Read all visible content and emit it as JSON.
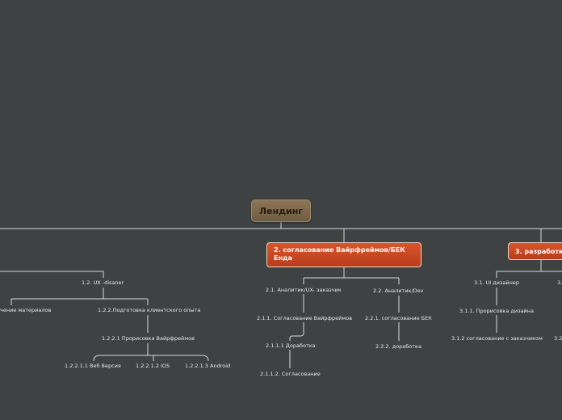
{
  "root": {
    "label": "Лендинг"
  },
  "branches": [
    {
      "label": "2. согласование Вайрфреймов/БЕК\nЕнда"
    },
    {
      "label": "3. разработк"
    }
  ],
  "nodes": {
    "ux_designer": "1.2. UX -disaner",
    "materials": "чение материалов",
    "client_exp": "1.2.2.Подготовка клиентского опыта",
    "wireframes": "1.2.2.1 Прорисовка Вайрфреймов",
    "web": "1.2.2.1.1 Веб Версия",
    "ios": "1.2.2.1.2 IOS",
    "android": "1.2.2.1.3 Android",
    "analyst_ux": "2.1. Аналитик/UX- заказчик",
    "agree_wire": "2.1.1. Согласование Вайрфреймов",
    "rework": "2.1.1.1 Доработка",
    "agreement": "2.1.1.2. Согласование",
    "analyst_dev": "2.2. Аналитик/Dev",
    "agree_back": "2.2.1. согласование БЕК",
    "rework2": "2.2.2. доработка",
    "ui_designer": "3.1. UI дизайнер",
    "design": "3.1.1. Прорисовка дизайна",
    "agree_client": "3.1.2 согласование с заказчиком",
    "cut1": "3.",
    "cut2": "3.2"
  }
}
